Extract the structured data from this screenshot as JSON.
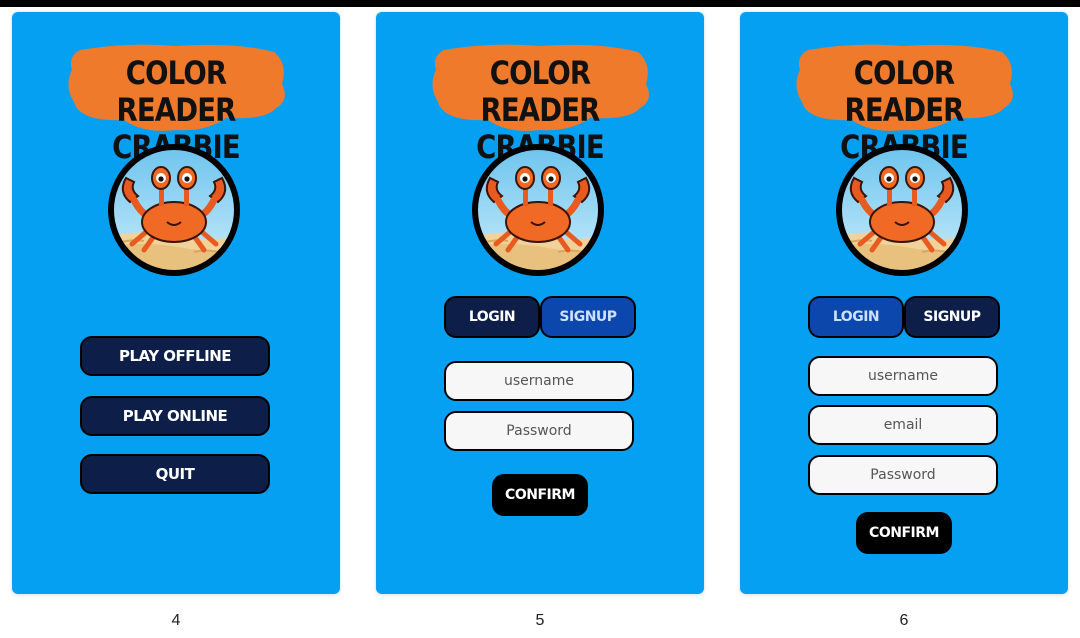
{
  "colors": {
    "card_background": "#06a0f2",
    "title_badge": "#f07a2c",
    "button_dark": "#0d1e48",
    "tab_active": "#0b47ad",
    "confirm": "#000000"
  },
  "app": {
    "title_line1": "COLOR READER",
    "title_line2": "CRABBIE",
    "logo_icon": "crab-icon"
  },
  "screens": [
    {
      "number": "4",
      "buttons": {
        "play_offline": "PLAY OFFLINE",
        "play_online": "PLAY ONLINE",
        "quit": "QUIT"
      }
    },
    {
      "number": "5",
      "tabs": {
        "login": "LOGIN",
        "signup": "SIGNUP",
        "active": "signup"
      },
      "fields": {
        "username_placeholder": "username",
        "password_placeholder": "Password"
      },
      "confirm": "CONFIRM"
    },
    {
      "number": "6",
      "tabs": {
        "login": "LOGIN",
        "signup": "SIGNUP",
        "active": "login"
      },
      "fields": {
        "username_placeholder": "username",
        "email_placeholder": "email",
        "password_placeholder": "Password"
      },
      "confirm": "CONFIRM"
    }
  ]
}
